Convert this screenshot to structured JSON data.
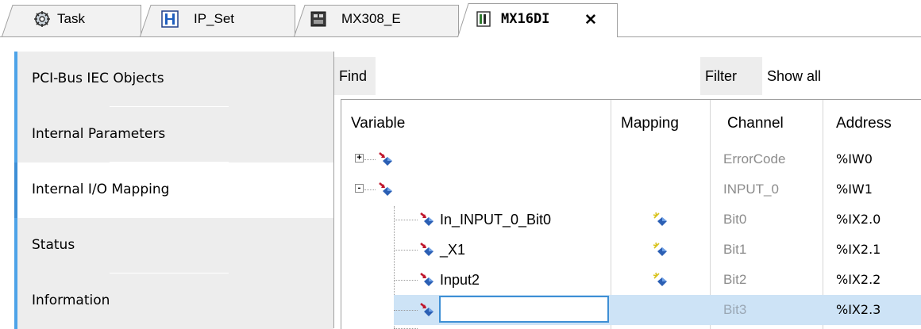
{
  "tabs": [
    {
      "label": "Task",
      "icon": "task-icon"
    },
    {
      "label": "IP_Set",
      "icon": "ip-set-icon"
    },
    {
      "label": "MX308_E",
      "icon": "device-icon"
    },
    {
      "label": "MX16DI",
      "icon": "module-icon",
      "active": true,
      "close": "✕"
    }
  ],
  "nav": {
    "items": [
      {
        "label": "PCI-Bus IEC Objects"
      },
      {
        "label": "Internal Parameters"
      },
      {
        "label": "Internal I/O Mapping",
        "active": true
      },
      {
        "label": "Status"
      },
      {
        "label": "Information"
      }
    ]
  },
  "findbar": {
    "find_label": "Find",
    "find_value": "",
    "filter_label": "Filter",
    "filter_value": "Show all"
  },
  "grid": {
    "headers": {
      "variable": "Variable",
      "mapping": "Mapping",
      "channel": "Channel",
      "address": "Address"
    },
    "rows": [
      {
        "variable": "",
        "channel": "ErrorCode",
        "address": "%IW0",
        "expander": "+",
        "mapped": false
      },
      {
        "variable": "",
        "channel": "INPUT_0",
        "address": "%IW1",
        "expander": "-",
        "mapped": false
      },
      {
        "variable": "In_INPUT_0_Bit0",
        "channel": "Bit0",
        "address": "%IX2.0",
        "mapped": true
      },
      {
        "variable": "_X1",
        "channel": "Bit1",
        "address": "%IX2.1",
        "mapped": true
      },
      {
        "variable": "Input2",
        "channel": "Bit2",
        "address": "%IX2.2",
        "mapped": true
      },
      {
        "variable": "",
        "channel": "Bit3",
        "address": "%IX2.3",
        "mapped": false,
        "editing": true
      }
    ]
  },
  "colors": {
    "accent": "#3e8fd5",
    "nav_bg": "#ededed",
    "selected_row": "#cde3f6",
    "channel_text": "#8c8c8c"
  }
}
